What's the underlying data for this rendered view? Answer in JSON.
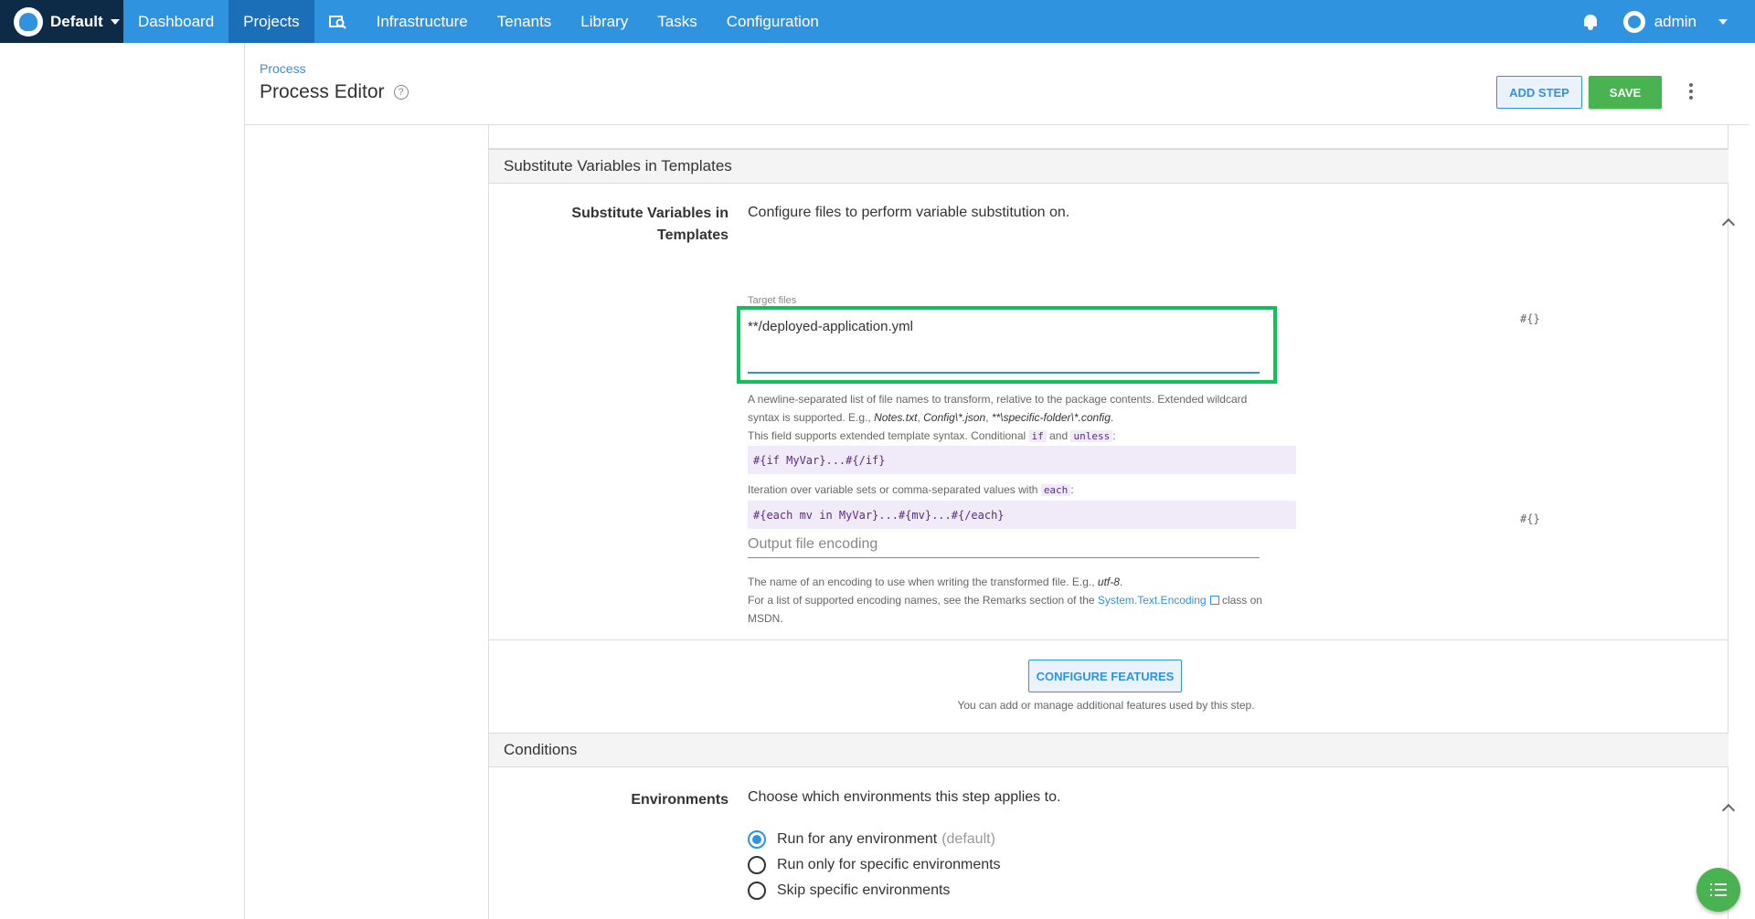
{
  "nav": {
    "space": "Default",
    "items": [
      "Dashboard",
      "Projects",
      "Infrastructure",
      "Tenants",
      "Library",
      "Tasks",
      "Configuration"
    ],
    "active": "Projects",
    "user": "admin",
    "brand_color": "#2f93e0",
    "space_bg": "#0d2a47"
  },
  "header": {
    "breadcrumb": "Process",
    "title": "Process Editor",
    "help_glyph": "?",
    "add_step": "ADD STEP",
    "save": "SAVE"
  },
  "substitute": {
    "section_title": "Substitute Variables in Templates",
    "label": "Substitute Variables in Templates",
    "description": "Configure files to perform variable substitution on.",
    "target_label": "Target files",
    "target_value": "**/deployed-application.yml",
    "variable_icon": "#{}",
    "help_line1": "A newline-separated list of file names to transform, relative to the package contents. Extended wildcard",
    "help_line2_prefix": "syntax is supported. E.g., ",
    "help_example1": "Notes.txt",
    "help_sep1": ", ",
    "help_example2": "Config\\*.json",
    "help_sep2": ", ",
    "help_example3": "**\\specific-folder\\*.config",
    "help_end": ".",
    "template_line_prefix": "This field supports extended template syntax. Conditional ",
    "kw_if": "if",
    "template_and": " and ",
    "kw_unless": "unless",
    "template_colon": ":",
    "code_if": "#{if MyVar}...#{/if}",
    "iteration_prefix": "Iteration over variable sets or comma-separated values with ",
    "kw_each": "each",
    "iteration_colon": ":",
    "code_each": "#{each mv in MyVar}...#{mv}...#{/each}",
    "encoding_placeholder": "Output file encoding",
    "encoding_help_prefix": "The name of an encoding to use when writing the transformed file. E.g., ",
    "encoding_example": "utf-8",
    "encoding_help_end": ".",
    "encoding_list_prefix": "For a list of supported encoding names, see the Remarks section of the ",
    "encoding_link": "System.Text.Encoding",
    "encoding_list_suffix": " class on",
    "encoding_list_line2": "MSDN."
  },
  "features": {
    "button": "CONFIGURE FEATURES",
    "hint": "You can add or manage additional features used by this step."
  },
  "conditions": {
    "section_title": "Conditions",
    "label": "Environments",
    "description": "Choose which environments this step applies to.",
    "options": [
      {
        "label": "Run for any environment",
        "suffix": "(default)",
        "checked": true
      },
      {
        "label": "Run only for specific environments",
        "suffix": "",
        "checked": false
      },
      {
        "label": "Skip specific environments",
        "suffix": "",
        "checked": false
      }
    ]
  }
}
